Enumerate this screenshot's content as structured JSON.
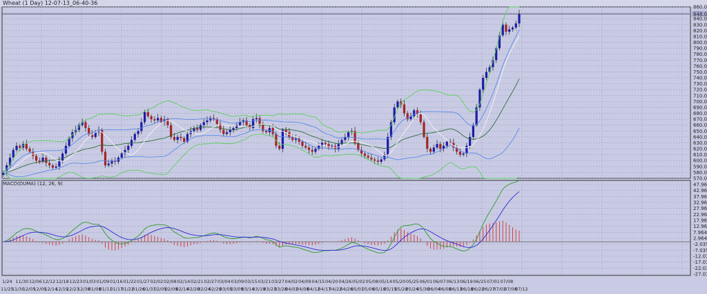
{
  "window": {
    "title": "Wheat (1 Day) 12-07-13_06-40-36"
  },
  "macd_panel": {
    "label": "MACD(DUMA) (12, 26, 9)"
  },
  "colors": {
    "background": "#c9cbe4",
    "bull": "#1c1ca8",
    "bear": "#a42424",
    "band_outer": "#5ad05a",
    "band_inner": "#5a8ae6",
    "middle": "#2f6a3a",
    "fast_ma": "#f4f4f4",
    "macd": "#2a9a2a",
    "signal": "#2a2ad0",
    "histogram": "#d04040"
  },
  "chart_data": [
    {
      "type": "candlestick",
      "title": "Wheat (1 Day)",
      "ylim": [
        570,
        860
      ],
      "y_ticks": [
        "860.00",
        "850.00",
        "840.00",
        "830.00",
        "820.00",
        "810.00",
        "800.00",
        "790.00",
        "780.00",
        "770.00",
        "760.00",
        "750.00",
        "740.00",
        "730.00",
        "720.00",
        "710.00",
        "700.00",
        "690.00",
        "680.00",
        "670.00",
        "660.00",
        "650.00",
        "640.00",
        "630.00",
        "620.00",
        "610.00",
        "600.00",
        "590.00",
        "580.00",
        "570.00"
      ],
      "current_price": 848,
      "current_price_label": "848.00",
      "indicators": [
        "Bollinger Bands (20, 2)",
        "Bollinger Bands (20, 1)",
        "SMA 20",
        "SMA 10"
      ],
      "closes": [
        580,
        592,
        605,
        618,
        625,
        622,
        628,
        620,
        615,
        608,
        600,
        598,
        605,
        596,
        592,
        588,
        590,
        600,
        612,
        625,
        638,
        648,
        652,
        660,
        665,
        655,
        645,
        640,
        648,
        652,
        615,
        592,
        595,
        600,
        598,
        605,
        612,
        618,
        625,
        635,
        645,
        650,
        665,
        682,
        675,
        670,
        668,
        672,
        665,
        670,
        660,
        640,
        635,
        640,
        638,
        632,
        645,
        650,
        655,
        652,
        660,
        665,
        668,
        672,
        670,
        662,
        652,
        645,
        648,
        652,
        655,
        660,
        665,
        668,
        660,
        655,
        670,
        672,
        660,
        650,
        648,
        655,
        645,
        625,
        620,
        652,
        648,
        640,
        635,
        638,
        632,
        625,
        622,
        618,
        615,
        620,
        625,
        630,
        628,
        622,
        625,
        620,
        628,
        635,
        640,
        648,
        650,
        630,
        618,
        612,
        608,
        605,
        602,
        600,
        598,
        602,
        610,
        640,
        665,
        690,
        700,
        695,
        680,
        670,
        675,
        685,
        678,
        665,
        640,
        620,
        615,
        622,
        628,
        620,
        625,
        632,
        630,
        622,
        615,
        610,
        612,
        625,
        640,
        660,
        690,
        720,
        740,
        750,
        758,
        770,
        790,
        812,
        830,
        818,
        822,
        825,
        832,
        848
      ],
      "x_ticks_top": [
        "1/24",
        "11/30",
        "12/06",
        "12/12",
        "12/18",
        "12/23",
        "01/03",
        "01/09",
        "01/16",
        "01/22",
        "01/27",
        "02/02",
        "02/08",
        "02/14",
        "02/21",
        "02/27",
        "03/04",
        "03/09",
        "03/15",
        "03/21",
        "03/27",
        "04/02",
        "04/09",
        "04/15",
        "04/20",
        "04/26",
        "05/02",
        "05/08",
        "05/14",
        "05/20",
        "05/25",
        "06/01",
        "06/07",
        "06/13",
        "06/19",
        "06/25",
        "07/01",
        "07/08"
      ],
      "x_ticks_bottom": [
        "11/25",
        "11/30",
        "12/05",
        "12/09",
        "12/14",
        "12/19",
        "12/23",
        "12/30",
        "01/08",
        "01/11",
        "01/17",
        "01/22",
        "01/26",
        "01/31",
        "02/05",
        "02/09",
        "02/14",
        "02/20",
        "02/24",
        "02/29",
        "03/05",
        "03/09",
        "03/14",
        "03/19",
        "03/23",
        "03/28",
        "04/02",
        "04/08",
        "04/12",
        "04/17",
        "04/22",
        "04/26",
        "05/01",
        "05/06",
        "05/10",
        "05/15",
        "05/20",
        "05/24",
        "05/30",
        "06/04",
        "06/08",
        "06/13",
        "06/18",
        "06/22",
        "06/27",
        "07/02",
        "07/08",
        "07/12"
      ]
    },
    {
      "type": "line",
      "title": "MACD(DUMA) (12, 26, 9)",
      "series": [
        {
          "name": "MACD"
        },
        {
          "name": "Signal"
        },
        {
          "name": "Histogram"
        }
      ],
      "ylim": [
        -27.0354,
        47.9646
      ],
      "y_ticks": [
        "47.9646",
        "42.9646",
        "37.9646",
        "32.9646",
        "27.9646",
        "22.9646",
        "17.9646",
        "12.9646",
        "7.9646",
        "2.9646",
        "-2.0354",
        "-7.0354",
        "-12.0354",
        "-17.0354",
        "-22.0354",
        "-27.0354"
      ]
    }
  ]
}
